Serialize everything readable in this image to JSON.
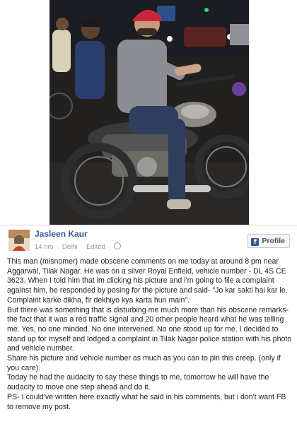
{
  "post": {
    "author": "Jasleen Kaur",
    "time": "14 hrs",
    "location": "Delhi",
    "edited": "Edited",
    "profile_label": "Profile",
    "paragraphs": [
      "This man (misnomer) made obscene comments on me today at around 8 pm near Aggarwal, Tilak Nagar. He was on a silver Royal Enfield, vehicle number - DL 4S CE 3623. When I told him that im clicking his picture and i'm going to file a complaint against him, he responded by posing for the picture and said- \"Jo kar sakti hai kar le. Complaint karke dikha, fir dekhiyo kya karta hun main\".",
      "But there was something that is disturbing me much more than his obscene remarks- the fact that it was a red traffic signal and 20 other people heard what he was telling me. Yes, no one minded. No one intervened. No one stood up for me. I decided to stand up for myself and lodged a complaint in Tilak Nagar police station with his photo and vehicle number.",
      "Share his picture and vehicle number as much as you can to pin this creep. (only if you care).",
      "Today he had the audacity to say these things to me, tomorrow he will have the audacity to move one step ahead and do it.",
      "PS- I could've written here exactly what he said in his comments, but i don't want FB to remove my post."
    ]
  },
  "icons": {
    "facebook": "facebook-icon",
    "globe": "globe-icon"
  }
}
